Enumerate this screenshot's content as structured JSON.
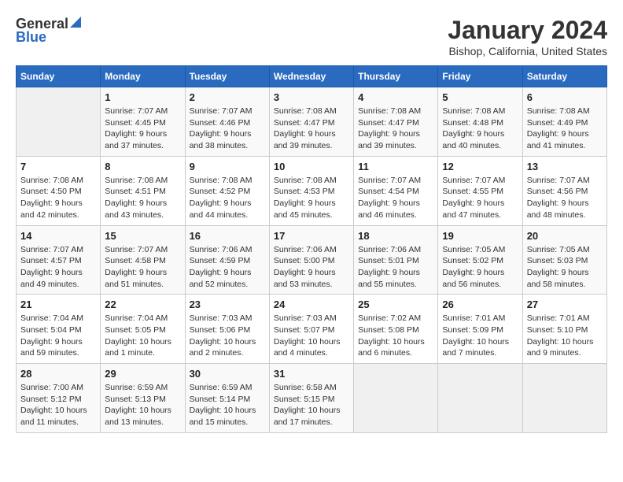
{
  "logo": {
    "general": "General",
    "blue": "Blue"
  },
  "title": "January 2024",
  "subtitle": "Bishop, California, United States",
  "days_of_week": [
    "Sunday",
    "Monday",
    "Tuesday",
    "Wednesday",
    "Thursday",
    "Friday",
    "Saturday"
  ],
  "weeks": [
    [
      {
        "day": "",
        "info": ""
      },
      {
        "day": "1",
        "info": "Sunrise: 7:07 AM\nSunset: 4:45 PM\nDaylight: 9 hours\nand 37 minutes."
      },
      {
        "day": "2",
        "info": "Sunrise: 7:07 AM\nSunset: 4:46 PM\nDaylight: 9 hours\nand 38 minutes."
      },
      {
        "day": "3",
        "info": "Sunrise: 7:08 AM\nSunset: 4:47 PM\nDaylight: 9 hours\nand 39 minutes."
      },
      {
        "day": "4",
        "info": "Sunrise: 7:08 AM\nSunset: 4:47 PM\nDaylight: 9 hours\nand 39 minutes."
      },
      {
        "day": "5",
        "info": "Sunrise: 7:08 AM\nSunset: 4:48 PM\nDaylight: 9 hours\nand 40 minutes."
      },
      {
        "day": "6",
        "info": "Sunrise: 7:08 AM\nSunset: 4:49 PM\nDaylight: 9 hours\nand 41 minutes."
      }
    ],
    [
      {
        "day": "7",
        "info": "Sunrise: 7:08 AM\nSunset: 4:50 PM\nDaylight: 9 hours\nand 42 minutes."
      },
      {
        "day": "8",
        "info": "Sunrise: 7:08 AM\nSunset: 4:51 PM\nDaylight: 9 hours\nand 43 minutes."
      },
      {
        "day": "9",
        "info": "Sunrise: 7:08 AM\nSunset: 4:52 PM\nDaylight: 9 hours\nand 44 minutes."
      },
      {
        "day": "10",
        "info": "Sunrise: 7:08 AM\nSunset: 4:53 PM\nDaylight: 9 hours\nand 45 minutes."
      },
      {
        "day": "11",
        "info": "Sunrise: 7:07 AM\nSunset: 4:54 PM\nDaylight: 9 hours\nand 46 minutes."
      },
      {
        "day": "12",
        "info": "Sunrise: 7:07 AM\nSunset: 4:55 PM\nDaylight: 9 hours\nand 47 minutes."
      },
      {
        "day": "13",
        "info": "Sunrise: 7:07 AM\nSunset: 4:56 PM\nDaylight: 9 hours\nand 48 minutes."
      }
    ],
    [
      {
        "day": "14",
        "info": "Sunrise: 7:07 AM\nSunset: 4:57 PM\nDaylight: 9 hours\nand 49 minutes."
      },
      {
        "day": "15",
        "info": "Sunrise: 7:07 AM\nSunset: 4:58 PM\nDaylight: 9 hours\nand 51 minutes."
      },
      {
        "day": "16",
        "info": "Sunrise: 7:06 AM\nSunset: 4:59 PM\nDaylight: 9 hours\nand 52 minutes."
      },
      {
        "day": "17",
        "info": "Sunrise: 7:06 AM\nSunset: 5:00 PM\nDaylight: 9 hours\nand 53 minutes."
      },
      {
        "day": "18",
        "info": "Sunrise: 7:06 AM\nSunset: 5:01 PM\nDaylight: 9 hours\nand 55 minutes."
      },
      {
        "day": "19",
        "info": "Sunrise: 7:05 AM\nSunset: 5:02 PM\nDaylight: 9 hours\nand 56 minutes."
      },
      {
        "day": "20",
        "info": "Sunrise: 7:05 AM\nSunset: 5:03 PM\nDaylight: 9 hours\nand 58 minutes."
      }
    ],
    [
      {
        "day": "21",
        "info": "Sunrise: 7:04 AM\nSunset: 5:04 PM\nDaylight: 9 hours\nand 59 minutes."
      },
      {
        "day": "22",
        "info": "Sunrise: 7:04 AM\nSunset: 5:05 PM\nDaylight: 10 hours\nand 1 minute."
      },
      {
        "day": "23",
        "info": "Sunrise: 7:03 AM\nSunset: 5:06 PM\nDaylight: 10 hours\nand 2 minutes."
      },
      {
        "day": "24",
        "info": "Sunrise: 7:03 AM\nSunset: 5:07 PM\nDaylight: 10 hours\nand 4 minutes."
      },
      {
        "day": "25",
        "info": "Sunrise: 7:02 AM\nSunset: 5:08 PM\nDaylight: 10 hours\nand 6 minutes."
      },
      {
        "day": "26",
        "info": "Sunrise: 7:01 AM\nSunset: 5:09 PM\nDaylight: 10 hours\nand 7 minutes."
      },
      {
        "day": "27",
        "info": "Sunrise: 7:01 AM\nSunset: 5:10 PM\nDaylight: 10 hours\nand 9 minutes."
      }
    ],
    [
      {
        "day": "28",
        "info": "Sunrise: 7:00 AM\nSunset: 5:12 PM\nDaylight: 10 hours\nand 11 minutes."
      },
      {
        "day": "29",
        "info": "Sunrise: 6:59 AM\nSunset: 5:13 PM\nDaylight: 10 hours\nand 13 minutes."
      },
      {
        "day": "30",
        "info": "Sunrise: 6:59 AM\nSunset: 5:14 PM\nDaylight: 10 hours\nand 15 minutes."
      },
      {
        "day": "31",
        "info": "Sunrise: 6:58 AM\nSunset: 5:15 PM\nDaylight: 10 hours\nand 17 minutes."
      },
      {
        "day": "",
        "info": ""
      },
      {
        "day": "",
        "info": ""
      },
      {
        "day": "",
        "info": ""
      }
    ]
  ]
}
